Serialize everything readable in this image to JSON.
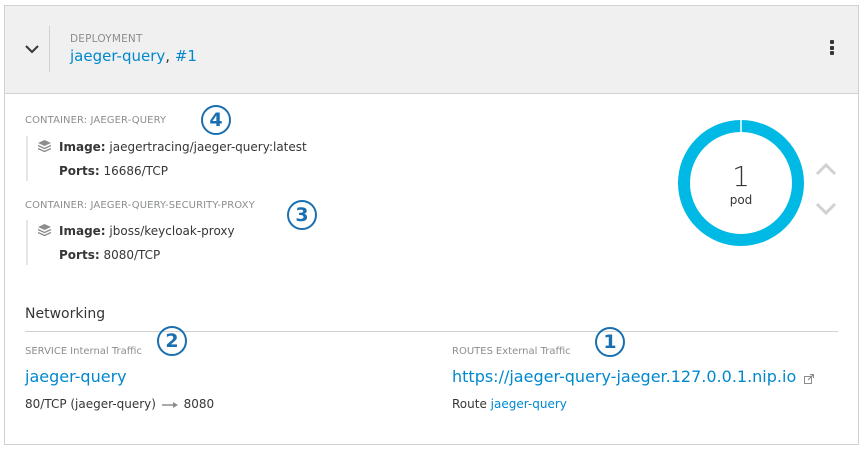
{
  "header": {
    "kind_label": "DEPLOYMENT",
    "name": "jaeger-query",
    "separator": ",",
    "revision": "#1"
  },
  "containers": [
    {
      "label": "CONTAINER: JAEGER-QUERY",
      "image_label": "Image:",
      "image": "jaegertracing/jaeger-query:latest",
      "ports_label": "Ports:",
      "ports": "16686/TCP",
      "annotation": "4"
    },
    {
      "label": "CONTAINER: JAEGER-QUERY-SECURITY-PROXY",
      "image_label": "Image:",
      "image": "jboss/keycloak-proxy",
      "ports_label": "Ports:",
      "ports": "8080/TCP",
      "annotation": "3"
    }
  ],
  "pods": {
    "count": "1",
    "label": "pod",
    "ring_color": "#00b9e4"
  },
  "networking": {
    "title": "Networking",
    "service": {
      "head": "SERVICE",
      "sub": "Internal Traffic",
      "name": "jaeger-query",
      "ports_from": "80/TCP (jaeger-query)",
      "ports_to": "8080",
      "annotation": "2"
    },
    "routes": {
      "head": "ROUTES",
      "sub": "External Traffic",
      "url": "https://jaeger-query-jaeger.127.0.0.1.nip.io",
      "route_label": "Route",
      "route_name": "jaeger-query",
      "annotation": "1"
    }
  },
  "colors": {
    "link": "#0088ce",
    "annotation": "#1a6fb0"
  }
}
